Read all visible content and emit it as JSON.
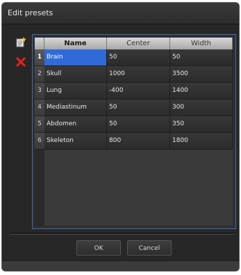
{
  "window": {
    "title": "Edit presets"
  },
  "toolbar": {
    "add_icon": "add-preset-icon",
    "delete_icon": "delete-preset-icon",
    "delete_color": "#e02020"
  },
  "table": {
    "columns": [
      "Name",
      "Center",
      "Width"
    ],
    "rows": [
      {
        "num": "1",
        "name": "Brain",
        "center": "50",
        "width": "50"
      },
      {
        "num": "2",
        "name": "Skull",
        "center": "1000",
        "width": "3500"
      },
      {
        "num": "3",
        "name": "Lung",
        "center": "-400",
        "width": "1400"
      },
      {
        "num": "4",
        "name": "Mediastinum",
        "center": "50",
        "width": "300"
      },
      {
        "num": "5",
        "name": "Abdomen",
        "center": "50",
        "width": "350"
      },
      {
        "num": "6",
        "name": "Skeleton",
        "center": "800",
        "width": "1800"
      }
    ],
    "selected_row": 0,
    "accent_color": "#2f6bd8"
  },
  "buttons": {
    "ok": "OK",
    "cancel": "Cancel"
  }
}
